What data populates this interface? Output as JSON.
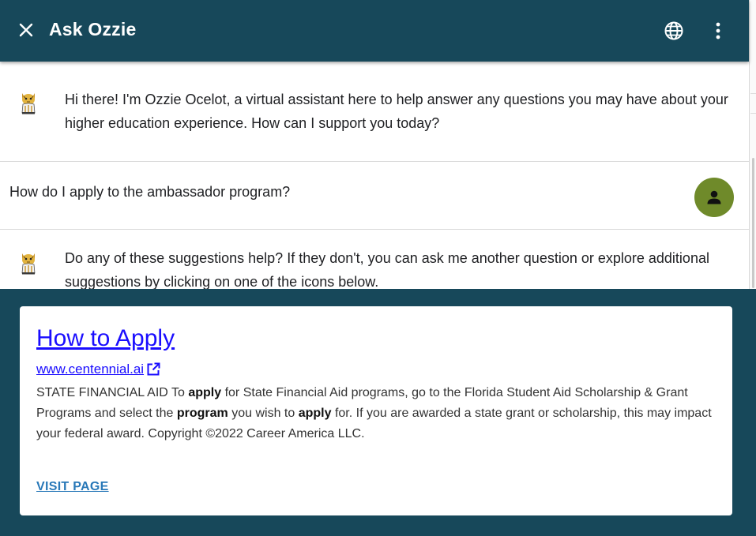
{
  "header": {
    "title": "Ask Ozzie"
  },
  "messages": {
    "bot_1": "Hi there! I'm Ozzie Ocelot, a virtual assistant here to help answer any questions you may have about your higher education experience. How can I support you today?",
    "user_1": "How do I apply to the ambassador program?",
    "bot_2": "Do any of these suggestions help? If they don't, you can ask me another question or explore additional suggestions by clicking on one of the icons below."
  },
  "card": {
    "title": "How to Apply",
    "url": "www.centennial.ai",
    "desc": {
      "p1": "STATE FINANCIAL AID To ",
      "b1": "apply",
      "p2": " for State Financial Aid programs, go to the Florida Student Aid Scholarship & Grant Programs and select the ",
      "b2": "program",
      "p3": " you wish to ",
      "b3": "apply",
      "p4": " for. If you are awarded a state grant or scholarship, this may impact your federal award. Copyright ©2022 Career America LLC."
    },
    "visit_label": "VISIT PAGE"
  },
  "icons": {
    "close": "close-icon",
    "language": "globe-icon",
    "menu": "more-vert-icon",
    "bot_avatar": "ocelot-mascot-icon",
    "user_avatar": "person-icon",
    "external_link": "open-in-new-icon"
  },
  "colors": {
    "header_bg": "#17485a",
    "user_avatar_bg": "#6f8a2a",
    "link": "#1a0dff",
    "visit_link": "#2878b8"
  }
}
